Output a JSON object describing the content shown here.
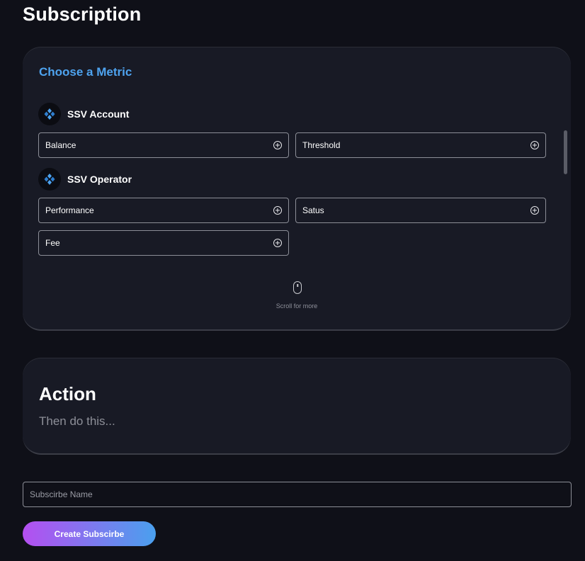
{
  "page": {
    "title": "Subscription"
  },
  "metric_card": {
    "heading": "Choose a Metric",
    "groups": [
      {
        "label": "SSV Account",
        "icon": "ssv-logo-icon",
        "metrics": [
          "Balance",
          "Threshold"
        ]
      },
      {
        "label": "SSV Operator",
        "icon": "ssv-logo-icon",
        "metrics": [
          "Performance",
          "Satus",
          "Fee"
        ]
      }
    ],
    "add_icon": "plus-circle-icon",
    "scroll_hint": "Scroll for more",
    "scroll_icon": "mouse-icon"
  },
  "action_card": {
    "title": "Action",
    "subtitle": "Then do this..."
  },
  "subscribe": {
    "name_placeholder": "Subscirbe Name",
    "name_value": "",
    "button_label": "Create Subscirbe"
  },
  "colors": {
    "background": "#0f1018",
    "card": "#181a25",
    "accent_blue": "#4ea3ef",
    "gradient_start": "#b54ff0",
    "gradient_end": "#4aa0ee"
  }
}
